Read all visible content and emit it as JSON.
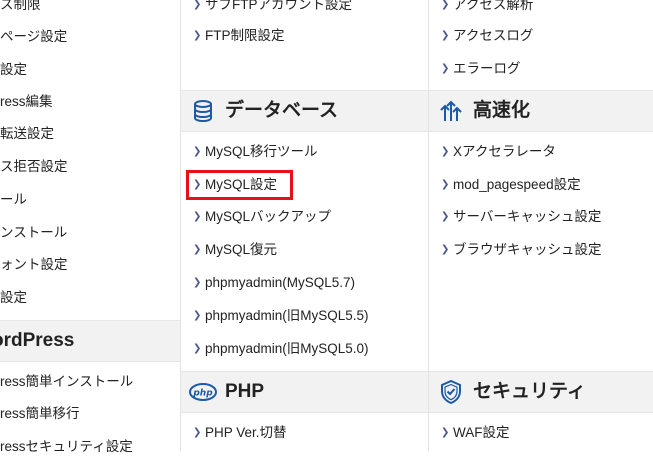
{
  "col1": {
    "items_top": [
      "ス制限",
      "ページ設定",
      "設定",
      "ress編集",
      "転送設定",
      "ス拒否設定",
      "ール",
      "ンストール",
      "ォント設定",
      "設定"
    ],
    "section_title": "ordPress",
    "items_bottom": [
      "ress簡単インストール",
      "ress簡単移行",
      "ressセキュリティ設定"
    ]
  },
  "col2": {
    "item_top_partial": "サブFTPアカウント設定",
    "items_top": [
      "FTP制限設定"
    ],
    "db_section": {
      "title": "データベース",
      "icon": "database-icon"
    },
    "db_items": [
      "MySQL移行ツール",
      "MySQL設定",
      "MySQLバックアップ",
      "MySQL復元",
      "phpmyadmin(MySQL5.7)",
      "phpmyadmin(旧MySQL5.5)",
      "phpmyadmin(旧MySQL5.0)"
    ],
    "php_section": {
      "title": "PHP",
      "icon": "php-icon",
      "icon_text": "php"
    },
    "php_items": [
      "PHP Ver.切替"
    ]
  },
  "col3": {
    "item_top_partial": "アクセス解析",
    "items_top": [
      "アクセスログ",
      "エラーログ"
    ],
    "speed_section": {
      "title": "高速化",
      "icon": "speed-arrows-icon"
    },
    "speed_items": [
      "Xアクセラレータ",
      "mod_pagespeed設定",
      "サーバーキャッシュ設定",
      "ブラウザキャッシュ設定"
    ],
    "security_section": {
      "title": "セキュリティ",
      "icon": "shield-check-icon"
    },
    "security_items": [
      "WAF設定"
    ]
  },
  "colors": {
    "accent": "#1a5aa8",
    "highlight": "#e8101a",
    "section_bg": "#f2f2f2"
  }
}
